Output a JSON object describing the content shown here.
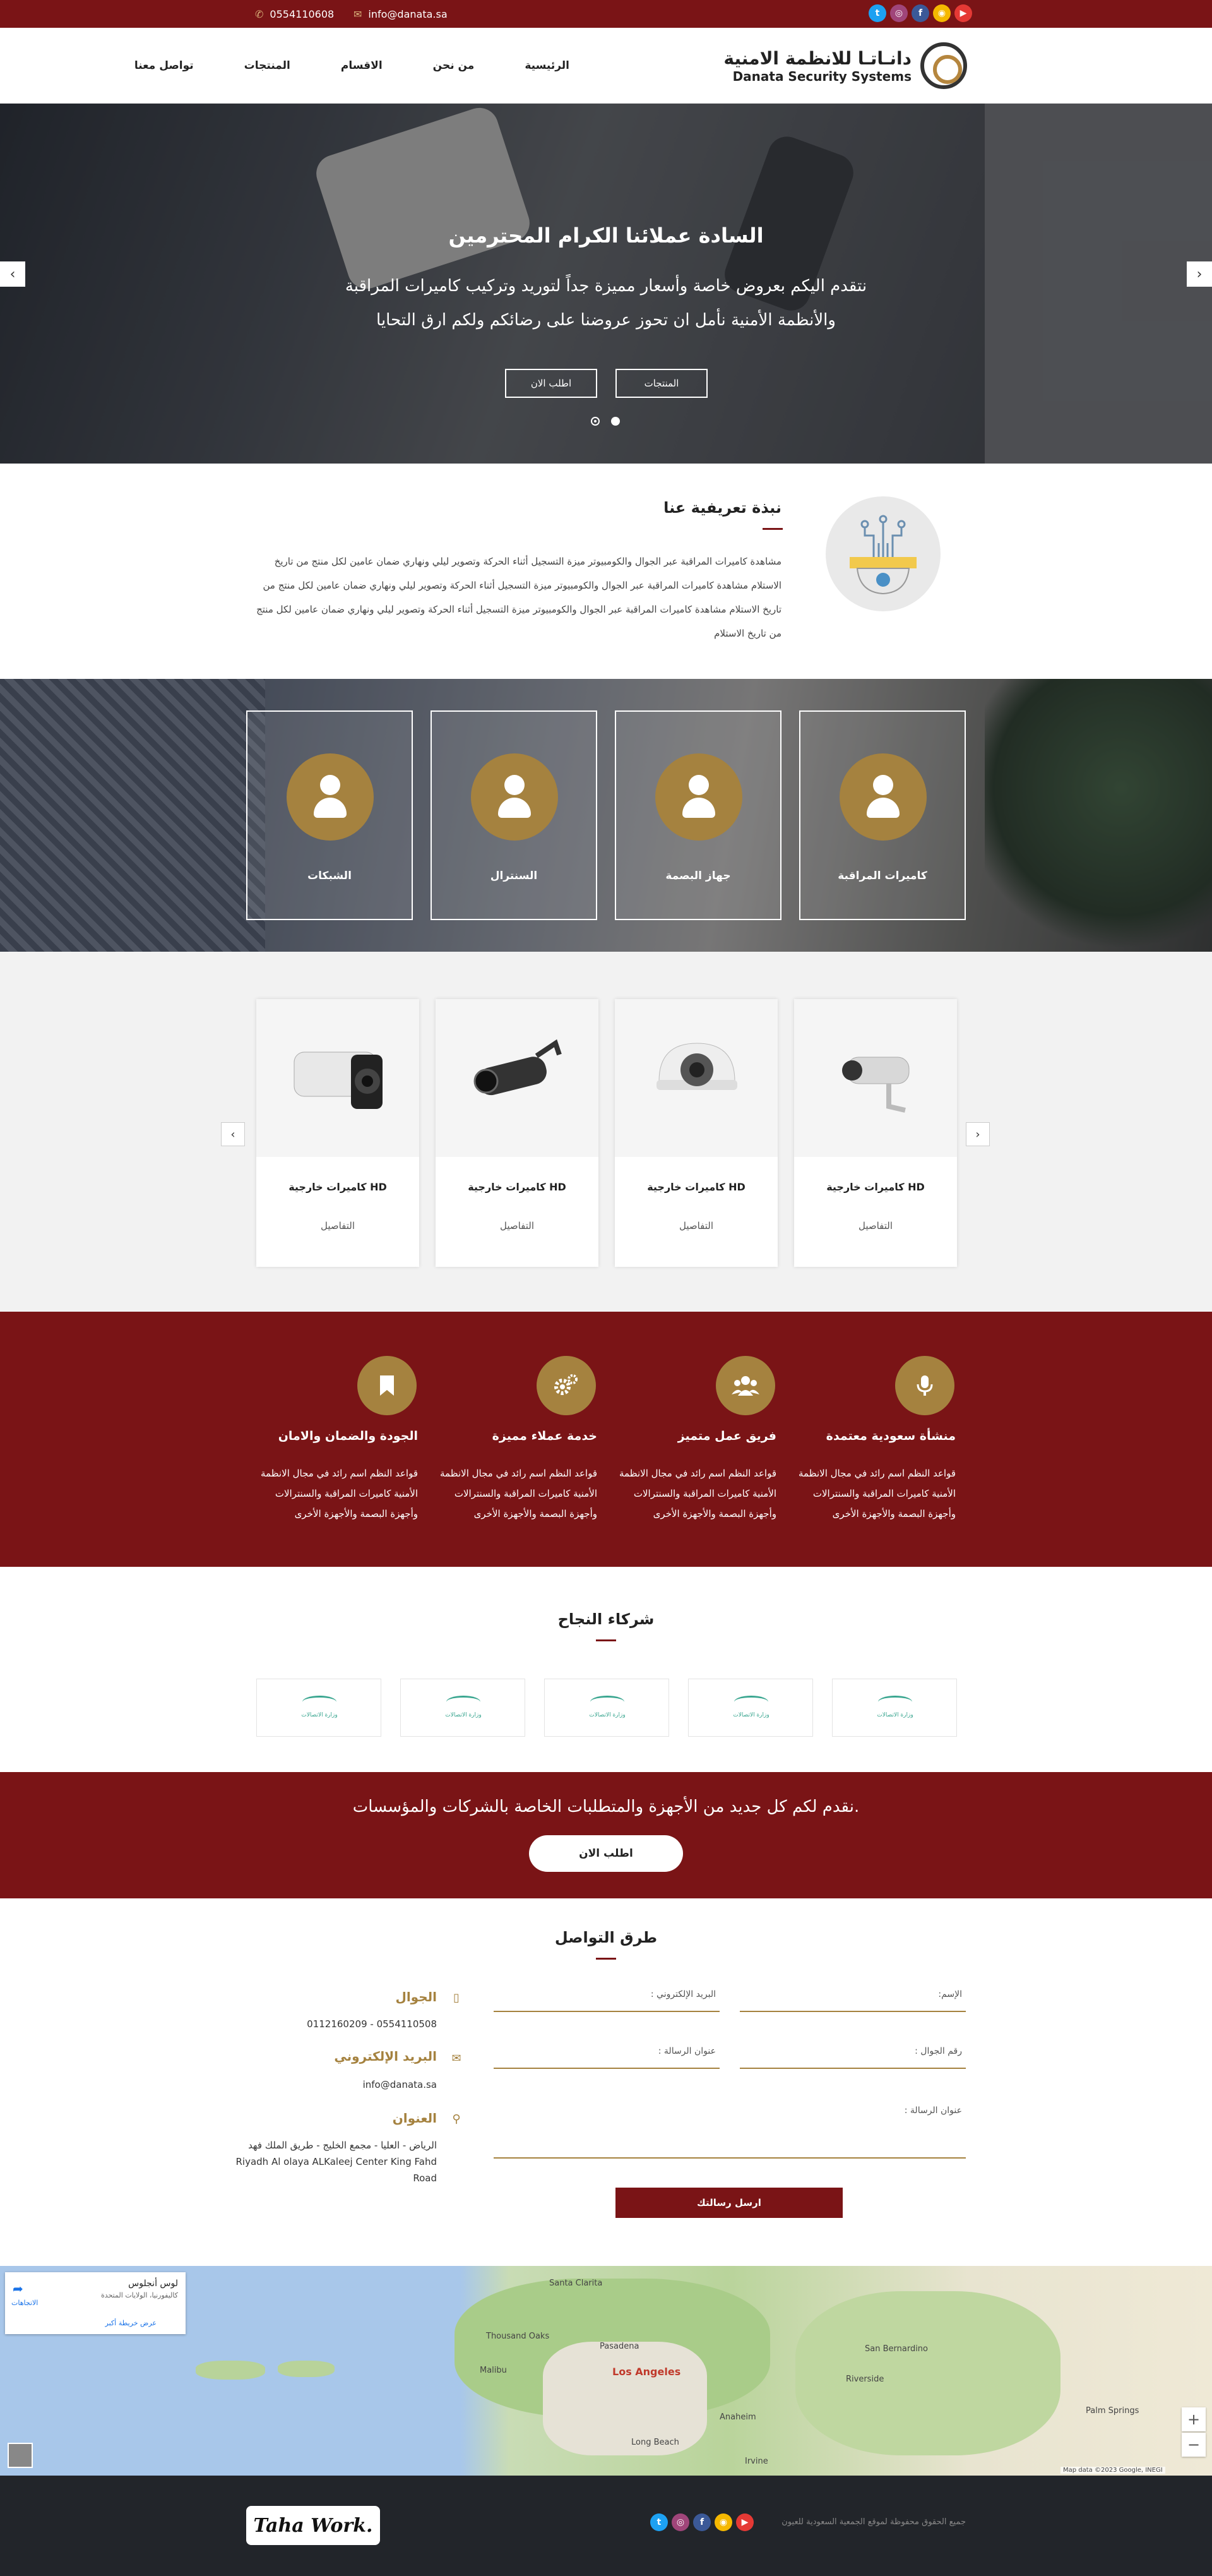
{
  "topbar": {
    "phone": "0554110608",
    "email": "info@danata.sa",
    "social": [
      {
        "icon": "youtube-icon",
        "glyph": "▶",
        "color": "#e53935"
      },
      {
        "icon": "snapchat-icon",
        "glyph": "◉",
        "color": "#f5b800"
      },
      {
        "icon": "facebook-icon",
        "glyph": "f",
        "color": "#3b5998"
      },
      {
        "icon": "instagram-icon",
        "glyph": "◎",
        "color": "#a0457a"
      },
      {
        "icon": "twitter-icon",
        "glyph": "t",
        "color": "#1da1f2"
      }
    ]
  },
  "header": {
    "logo_ar": "دانـاتـا للانظمة الامنية",
    "logo_en": "Danata Security Systems",
    "nav": [
      "الرئيسية",
      "من نحن",
      "الاقسام",
      "المنتجات",
      "تواصل معنا"
    ]
  },
  "hero": {
    "title": "السادة عملائنا الكرام المحترمين",
    "subtitle": "نتقدم اليكم بعروض خاصة وأسعار مميزة جداً لتوريد وتركيب كاميرات المراقبة والأنظمة الأمنية نأمل ان تحوز عروضنا على رضائكم ولكم ارق التحايا",
    "btn_products": "المنتجات",
    "btn_order": "اطلب الان",
    "prev": "‹",
    "next": "›"
  },
  "about": {
    "title": "نبذة تعريفية عنا",
    "text": "مشاهدة كاميرات المراقبة عبر الجوال والكومبيوتر ميزة التسجيل أثناء الحركة وتصوير ليلي ونهاري ضمان عامين لكل منتج من تاريخ الاستلام مشاهدة كاميرات المراقبة عبر الجوال والكومبيوتر ميزة التسجيل أثناء الحركة وتصوير ليلي ونهاري ضمان عامين لكل منتج من تاريخ الاستلام مشاهدة كاميرات المراقبة عبر الجوال والكومبيوتر ميزة التسجيل أثناء الحركة وتصوير ليلي ونهاري ضمان عامين لكل منتج من تاريخ الاستلام"
  },
  "services": [
    "كاميرات المراقبة",
    "جهاز البصمة",
    "السنترال",
    "الشبكات"
  ],
  "products": {
    "items": [
      {
        "title": "كاميرات خارجية HD",
        "link": "التفاصيل"
      },
      {
        "title": "كاميرات خارجية HD",
        "link": "التفاصيل"
      },
      {
        "title": "كاميرات خارجية HD",
        "link": "التفاصيل"
      },
      {
        "title": "كاميرات خارجية HD",
        "link": "التفاصيل"
      }
    ],
    "prev": "‹",
    "next": "›"
  },
  "features": [
    {
      "icon": "microphone-icon",
      "title": "منشأة سعودية معتمدة",
      "text": "قواعد النظم اسم رائد في مجال الانظمة الأمنية كاميرات المراقبة والسنترالات وأجهزة البصمة والأجهزة الأخرى"
    },
    {
      "icon": "team-icon",
      "title": "فريق عمل متميز",
      "text": "قواعد النظم اسم رائد في مجال الانظمة الأمنية كاميرات المراقبة والسنترالات وأجهزة البصمة والأجهزة الأخرى"
    },
    {
      "icon": "gears-icon",
      "title": "خدمة عملاء مميزة",
      "text": "قواعد النظم اسم رائد في مجال الانظمة الأمنية كاميرات المراقبة والسنترالات وأجهزة البصمة والأجهزة الأخرى"
    },
    {
      "icon": "bookmark-icon",
      "title": "الجودة والضمان والامان",
      "text": "قواعد النظم اسم رائد في مجال الانظمة الأمنية كاميرات المراقبة والسنترالات وأجهزة البصمة والأجهزة الأخرى"
    }
  ],
  "partners": {
    "title": "شركاء النجاح",
    "logo_text": "وزارة الاتصالات",
    "count_label": [
      "",
      "",
      "",
      "",
      ""
    ]
  },
  "cta": {
    "text": "نقدم لكم كل جديد من الأجهزة والمتطلبات الخاصة بالشركات والمؤسسات.",
    "button": "اطلب الان"
  },
  "contact": {
    "title": "طرق التواصل",
    "placeholders": {
      "name": "الإسم:",
      "email": "البريد الإلكتروني :",
      "phone": "رقم الجوال :",
      "subject": "عنوان الرسالة :",
      "message": "عنوان الرسالة :"
    },
    "send": "ارسل رسالتك",
    "mobile_title": "الجوال",
    "mobile_value": "0554110508 - 0112160209",
    "email_title": "البريد الإلكتروني",
    "email_value": "info@danata.sa",
    "address_title": "العنوان",
    "address_value": "الرياض - العليا - مجمع الخليج - طريق الملك فهد Riyadh Al olaya ALKaleej Center King Fahd Road"
  },
  "map": {
    "card_title": "لوس أنجلوس",
    "card_sub": "كاليفورنيا، الولايات المتحدة",
    "card_dir": "الاتجاهات",
    "card_link": "عرض خريطة أكبر",
    "cities": [
      "Santa Clarita",
      "Pasadena",
      "Los Angeles",
      "Thousand Oaks",
      "Long Beach",
      "Riverside",
      "San Bernardino",
      "Anaheim",
      "Irvine",
      "Palm Springs",
      "Malibu"
    ],
    "attribution": "Map data ©2023 Google, INEGI"
  },
  "footer": {
    "copyright": "جميع الحقوق محفوظة لموقع الجمعية السعودية للعيون",
    "brand": "Taha Work."
  }
}
